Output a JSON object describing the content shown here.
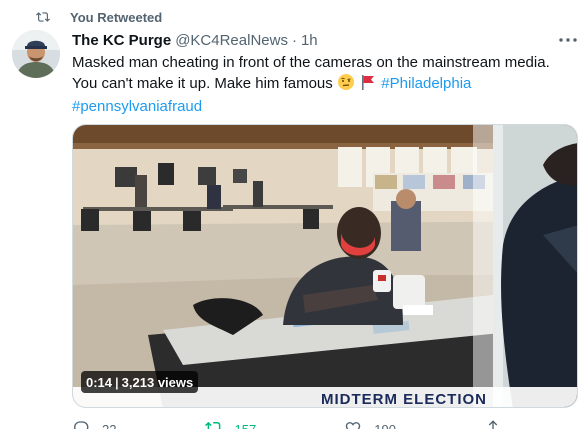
{
  "social_context": {
    "label": "You Retweeted",
    "icon": "retweet-icon"
  },
  "author": {
    "display_name": "The KC Purge",
    "handle": "@KC4RealNews",
    "separator": "·",
    "time": "1h"
  },
  "tweet": {
    "line1": "Masked man cheating in front of the cameras on the mainstream media.",
    "line2": "You can't make it up. Make him famous",
    "hashtag1": "#Philadelphia",
    "hashtag2": "#pennsylvaniafraud"
  },
  "video": {
    "time": "0:14",
    "separator": "|",
    "views": "3,213 views",
    "banner_text": "MIDTERM ELECTION"
  },
  "actions": {
    "reply": {
      "icon": "reply-icon",
      "count": "22"
    },
    "retweet": {
      "icon": "retweet-icon",
      "count": "157"
    },
    "like": {
      "icon": "heart-icon",
      "count": "190"
    },
    "share": {
      "icon": "share-icon"
    }
  },
  "colors": {
    "accent": "#1d9bf0",
    "retweet_green": "#00ba7c",
    "muted": "#536471"
  }
}
